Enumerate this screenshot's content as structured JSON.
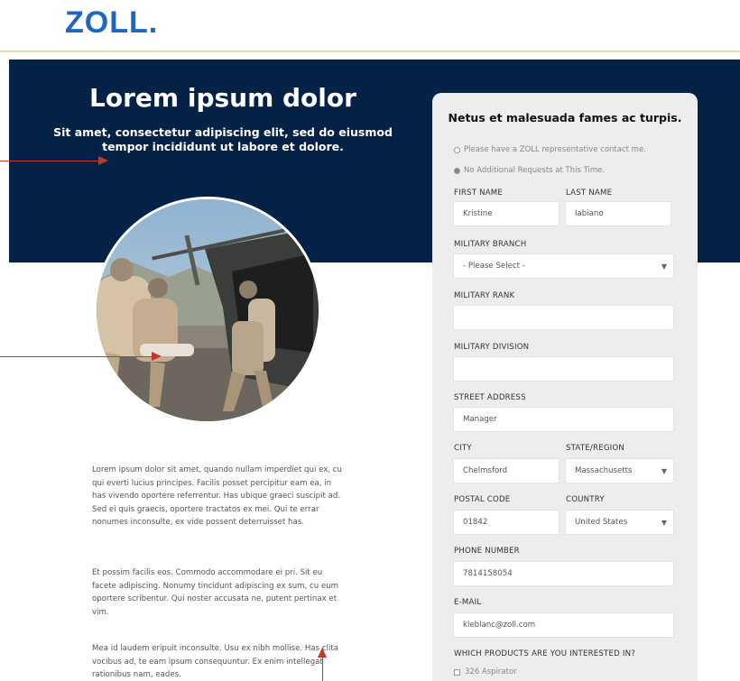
{
  "brand": {
    "logo": "ZOLL."
  },
  "hero": {
    "title": "Lorem ipsum dolor",
    "subtitle": "Sit amet, consectetur adipiscing elit, sed do eiusmod tempor incididunt ut labore et dolore."
  },
  "body": {
    "paragraphs": [
      "Lorem ipsum dolor sit amet, quando nullam imperdiet qui ex, cu qui everti lucius principes. Facilis posset percipitur eam ea, in has vivendo oportere referrentur. Has ubique graeci suscipit ad. Sed ei quis graecis, oportere tractatos ex mei. Qui te errar nonumes inconsulte, ex vide possent deterruisset has.",
      "Et possim facilis eos. Commodo accommodare ei pri. Sit eu facete adipiscing. Nonumy tincidunt adipiscing ex sum, cu eum oportere scribentur. Qui noster accusata ne, putent pertinax et vim.",
      "Mea id laudem eripuit inconsulte. Usu ex nibh mollise. Has clita vocibus ad, te eam ipsum consequuntur. Ex enim intellegat rationibus nam, eades."
    ]
  },
  "form": {
    "title": "Netus et malesuada fames ac turpis.",
    "options": [
      {
        "label": "Please have a ZOLL representative contact me.",
        "selected": false
      },
      {
        "label": "No Additional Requests at This Time.",
        "selected": true
      }
    ],
    "fields": {
      "first_name": {
        "label": "FIRST NAME",
        "value": "Kristine"
      },
      "last_name": {
        "label": "LAST NAME",
        "value": "Iabiano"
      },
      "branch": {
        "label": "MILITARY BRANCH",
        "value": "- Please Select -"
      },
      "rank": {
        "label": "MILITARY RANK",
        "value": ""
      },
      "division": {
        "label": "MILITARY DIVISION",
        "value": ""
      },
      "street": {
        "label": "STREET ADDRESS",
        "value": "Manager"
      },
      "city": {
        "label": "CITY",
        "value": "Chelmsford"
      },
      "state": {
        "label": "STATE/REGION",
        "value": "Massachusetts"
      },
      "postal": {
        "label": "POSTAL CODE",
        "value": "01842"
      },
      "country": {
        "label": "COUNTRY",
        "value": "United States"
      },
      "phone": {
        "label": "PHONE NUMBER",
        "value": "7814158054"
      },
      "email": {
        "label": "E-MAIL",
        "value": "kleblanc@zoll.com"
      }
    },
    "products": {
      "label": "WHICH PRODUCTS ARE YOU INTERESTED IN?",
      "items": [
        {
          "label": "326 Aspirator",
          "checked": false
        }
      ]
    }
  },
  "icons": {
    "dropdown": "chevron-down-icon",
    "arrow": "arrow-icon"
  },
  "colors": {
    "brand_blue": "#1f66c1",
    "hero_navy": "#042146",
    "accent_line": "#d9e3a8",
    "annotation_red": "#c0392b",
    "form_bg": "#ededed"
  }
}
